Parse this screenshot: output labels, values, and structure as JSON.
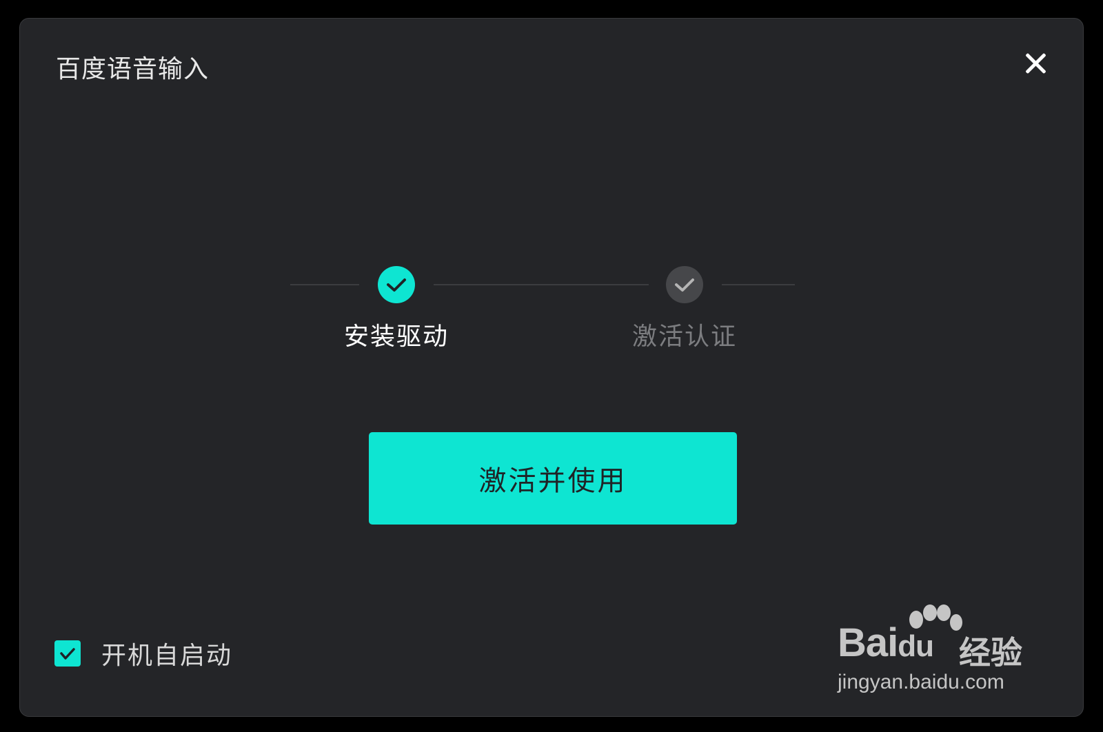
{
  "window": {
    "title": "百度语音输入",
    "close_icon": "close-icon"
  },
  "steps": [
    {
      "label": "安装驱动",
      "status": "completed",
      "color": "#0ee5d2"
    },
    {
      "label": "激活认证",
      "status": "pending",
      "color": "#46474a"
    }
  ],
  "primary_button": {
    "label": "激活并使用",
    "color": "#0ee5d2"
  },
  "autostart": {
    "label": "开机自启动",
    "checked": true
  },
  "watermark": {
    "logo_text": "Bai",
    "logo_text_2": "du",
    "cn_text": "经验",
    "url": "jingyan.baidu.com"
  },
  "colors": {
    "background": "#242528",
    "accent": "#0ee5d2",
    "inactive": "#46474a",
    "text": "#e9e9e9"
  }
}
